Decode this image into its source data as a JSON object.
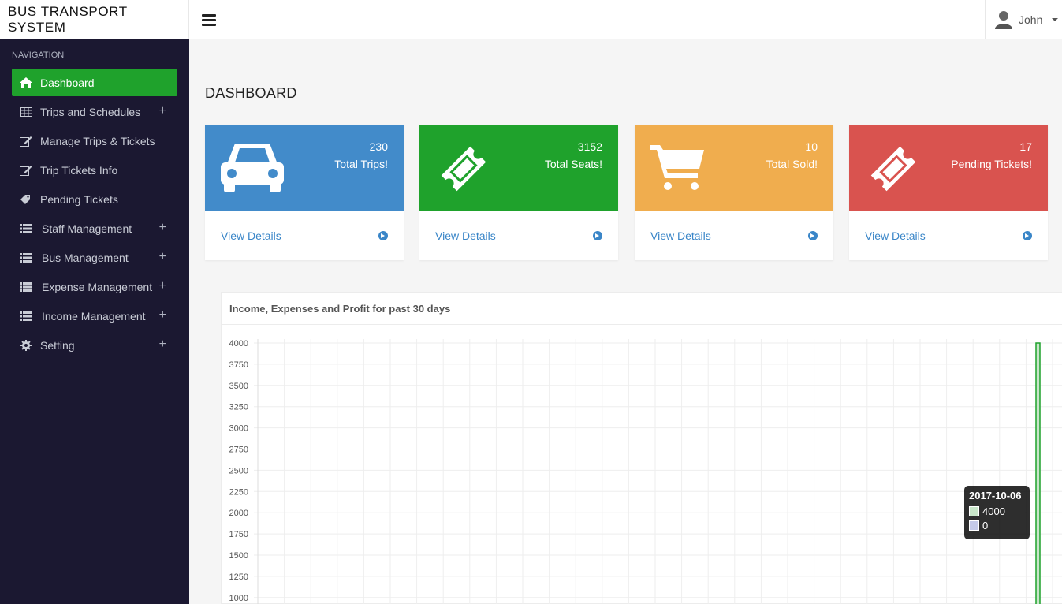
{
  "app": {
    "title": "BUS TRANSPORT SYSTEM"
  },
  "topbar": {
    "user_name": "John"
  },
  "sidebar": {
    "header": "NAVIGATION",
    "items": [
      {
        "label": "Dashboard",
        "icon": "home-icon",
        "active": true,
        "expandable": false
      },
      {
        "label": "Trips and Schedules",
        "icon": "table-icon",
        "expandable": true
      },
      {
        "label": "Manage Trips & Tickets",
        "icon": "edit-icon",
        "expandable": false
      },
      {
        "label": "Trip Tickets Info",
        "icon": "edit-icon",
        "expandable": false
      },
      {
        "label": "Pending Tickets",
        "icon": "tag-icon",
        "expandable": false
      },
      {
        "label": "Staff Management",
        "icon": "list-icon",
        "expandable": true
      },
      {
        "label": "Bus Management",
        "icon": "list-icon",
        "expandable": true
      },
      {
        "label": "Expense Management",
        "icon": "list-icon",
        "expandable": true
      },
      {
        "label": "Income Management",
        "icon": "list-icon",
        "expandable": true
      },
      {
        "label": "Setting",
        "icon": "gear-icon",
        "expandable": true
      }
    ]
  },
  "main": {
    "title": "DASHBOARD",
    "cards": [
      {
        "value": "230",
        "label": "Total Trips!",
        "link": "View Details",
        "color": "#428bca",
        "icon": "car-icon"
      },
      {
        "value": "3152",
        "label": "Total Seats!",
        "link": "View Details",
        "color": "#1fa22c",
        "icon": "ticket-icon"
      },
      {
        "value": "10",
        "label": "Total Sold!",
        "link": "View Details",
        "color": "#f0ad4e",
        "icon": "cart-icon"
      },
      {
        "value": "17",
        "label": "Pending Tickets!",
        "link": "View Details",
        "color": "#d9534f",
        "icon": "ticket-icon"
      }
    ]
  },
  "chart_panel": {
    "title": "Income, Expenses and Profit for past 30 days"
  },
  "chart_data": {
    "type": "bar",
    "title": "Income, Expenses and Profit for past 30 days",
    "y_ticks": [
      4000,
      3750,
      3500,
      3250,
      3000,
      2750,
      2500,
      2250,
      2000,
      1750,
      1500,
      1250,
      1000
    ],
    "ylim": [
      1000,
      4000
    ],
    "grid": true,
    "categories_count": 30,
    "visible_bar": {
      "category": "2017-10-06",
      "value": 4000
    },
    "series": [
      {
        "values_at_visible_bar": 4000,
        "color": "#c8e6c9"
      },
      {
        "values_at_visible_bar": 0,
        "color": "#c5cae9"
      }
    ]
  },
  "tooltip": {
    "date": "2017-10-06",
    "rows": [
      {
        "value": "4000",
        "color": "#c8e6c9"
      },
      {
        "value": "0",
        "color": "#c5cae9"
      }
    ]
  }
}
